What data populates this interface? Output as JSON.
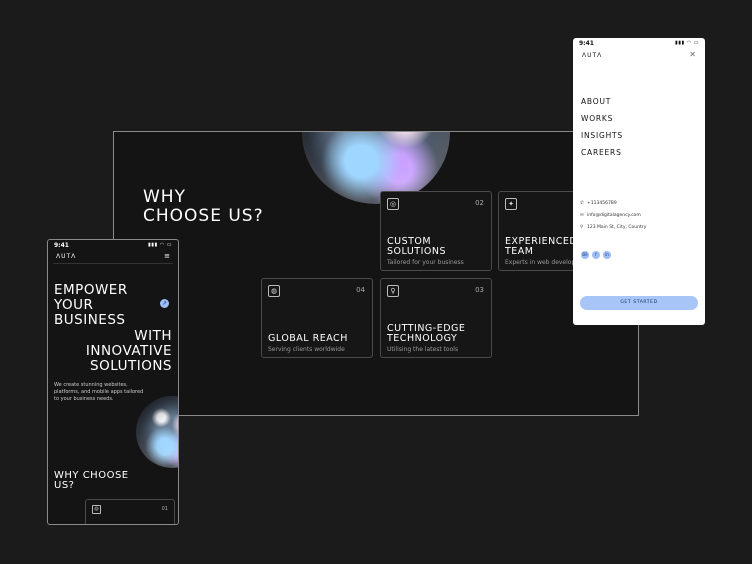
{
  "desktop": {
    "heading_line1": "WHY",
    "heading_line2": "CHOOSE US?",
    "cards": [
      {
        "num": "02",
        "title1": "CUSTOM",
        "title2": "SOLUTIONS",
        "subtitle": "Tailored for your business",
        "icon": "target-icon"
      },
      {
        "num": "",
        "title1": "EXPERIENCED",
        "title2": "TEAM",
        "subtitle": "Experts in web develop",
        "icon": "team-icon"
      },
      {
        "num": "04",
        "title1": "GLOBAL REACH",
        "title2": "",
        "subtitle": "Serving clients worldwide",
        "icon": "globe-icon"
      },
      {
        "num": "03",
        "title1": "CUTTING-EDGE",
        "title2": "TECHNOLOGY",
        "subtitle": "Utilising the latest tools",
        "icon": "lightbulb-icon"
      }
    ]
  },
  "mobile_left": {
    "time": "9:41",
    "logo": "ΛUΤΛ",
    "hero": [
      "EMPOWER",
      "YOUR",
      "BUSINESS",
      "WITH",
      "INNOVATIVE",
      "SOLUTIONS"
    ],
    "description": "We create stunning websites, platforms, and mobile apps tailored to your business needs.",
    "why_line1": "WHY CHOOSE",
    "why_line2": "US?",
    "card_num": "01"
  },
  "mobile_right": {
    "time": "9:41",
    "logo": "ΛUΤΛ",
    "nav": [
      "ABOUT",
      "WORKS",
      "INSIGHTS",
      "CAREERS"
    ],
    "phone": "+1134567B9",
    "email": "info@digitalagency.com",
    "address": "123 Main St, City, Country",
    "button": "GET STARTED"
  },
  "colors": {
    "background": "#1b1b1b",
    "accent": "#a8c5f7"
  }
}
